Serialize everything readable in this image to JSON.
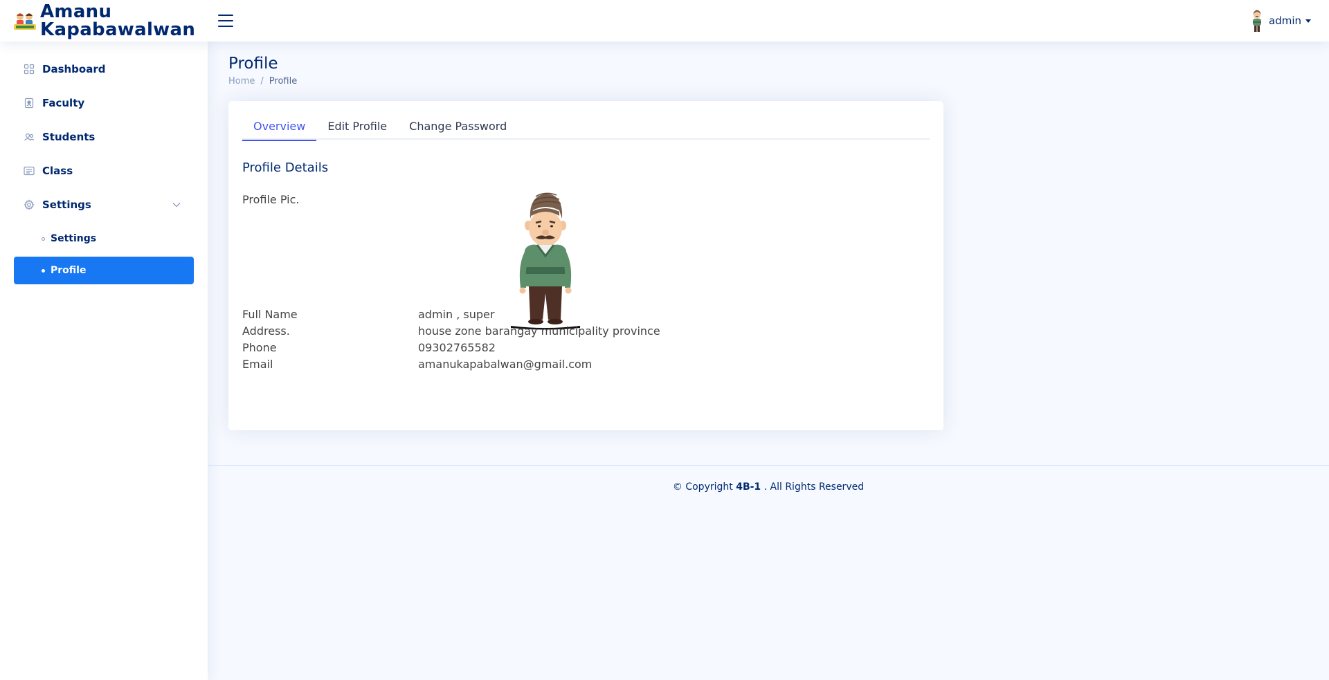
{
  "app": {
    "brand_line1": "Amanu",
    "brand_line2": "Kapabawalwan",
    "user": "admin"
  },
  "sidebar": {
    "items": [
      {
        "label": "Dashboard",
        "icon": "grid-icon"
      },
      {
        "label": "Faculty",
        "icon": "badge-icon"
      },
      {
        "label": "Students",
        "icon": "people-icon"
      },
      {
        "label": "Class",
        "icon": "card-list-icon"
      },
      {
        "label": "Settings",
        "icon": "gear-icon"
      }
    ],
    "sub_items": [
      {
        "label": "Settings",
        "active": false
      },
      {
        "label": "Profile",
        "active": true
      }
    ]
  },
  "page": {
    "title": "Profile",
    "breadcrumb_home": "Home",
    "breadcrumb_sep": "/",
    "breadcrumb_current": "Profile"
  },
  "tabs": [
    {
      "label": "Overview",
      "active": true
    },
    {
      "label": "Edit Profile",
      "active": false
    },
    {
      "label": "Change Password",
      "active": false
    }
  ],
  "profile": {
    "section_title": "Profile Details",
    "pic_label": "Profile Pic.",
    "fields": [
      {
        "label": "Full Name",
        "value": "admin , super"
      },
      {
        "label": "Address.",
        "value": "house zone barangay municipality province"
      },
      {
        "label": "Phone",
        "value": "09302765582"
      },
      {
        "label": "Email",
        "value": "amanukapabalwan@gmail.com"
      }
    ]
  },
  "footer": {
    "prefix": "© Copyright ",
    "owner": "4B-1",
    "suffix": " . All Rights Reserved"
  },
  "colors": {
    "brand": "#012970",
    "accent": "#4154f1",
    "active_nav": "#1877f2",
    "background": "#f6f9ff"
  }
}
